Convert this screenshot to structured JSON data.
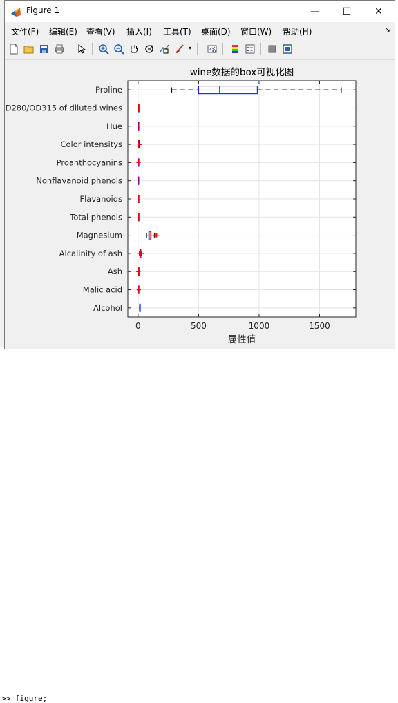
{
  "window": {
    "title": "Figure 1"
  },
  "titlebar_buttons": {
    "minimize": "—",
    "maximize": "☐",
    "close": "✕"
  },
  "menu": [
    {
      "label": "文件(F)"
    },
    {
      "label": "编辑(E)"
    },
    {
      "label": "查看(V)"
    },
    {
      "label": "插入(I)"
    },
    {
      "label": "工具(T)"
    },
    {
      "label": "桌面(D)"
    },
    {
      "label": "窗口(W)"
    },
    {
      "label": "帮助(H)"
    }
  ],
  "toolbar": [
    {
      "icon": "new-figure-icon"
    },
    {
      "icon": "open-file-icon"
    },
    {
      "icon": "save-icon"
    },
    {
      "icon": "print-icon"
    },
    {
      "icon": "edit-plot-arrow-icon"
    },
    {
      "icon": "zoom-in-icon"
    },
    {
      "icon": "zoom-out-icon"
    },
    {
      "icon": "pan-hand-icon"
    },
    {
      "icon": "rotate-3d-icon"
    },
    {
      "icon": "data-cursor-icon"
    },
    {
      "icon": "brush-icon"
    },
    {
      "icon": "link-plot-icon"
    },
    {
      "icon": "colorbar-icon"
    },
    {
      "icon": "legend-icon"
    },
    {
      "icon": "hide-plot-tools-icon"
    },
    {
      "icon": "show-plot-tools-icon"
    }
  ],
  "console": {
    "text": ">> figure;"
  },
  "chart_data": {
    "type": "box",
    "orientation": "horizontal",
    "title": "wine数据的box可视化图",
    "xlabel": "属性值",
    "ylabel": "",
    "xlim": [
      -85,
      1800
    ],
    "xticks": [
      0,
      500,
      1000,
      1500
    ],
    "grid": true,
    "colors": {
      "box": "#0000ff",
      "median": "#ff0000",
      "whisker": "#000000",
      "outlier": "#ff0000"
    },
    "categories": [
      "Proline",
      "OD280/OD315 of diluted wines",
      "Hue",
      "Color intensitys",
      "Proanthocyanins",
      "Nonflavanoid phenols",
      "Flavanoids",
      "Total phenols",
      "Magnesium",
      "Alcalinity of ash",
      "Ash",
      "Malic acid",
      "Alcohol"
    ],
    "boxes": [
      {
        "name": "Proline",
        "min": 278,
        "q1": 500,
        "median": 673,
        "q3": 985,
        "max": 1680,
        "outliers": []
      },
      {
        "name": "OD280/OD315 of diluted wines",
        "min": 1.27,
        "q1": 1.93,
        "median": 2.78,
        "q3": 3.17,
        "max": 4.0,
        "outliers": []
      },
      {
        "name": "Hue",
        "min": 0.48,
        "q1": 0.78,
        "median": 0.965,
        "q3": 1.12,
        "max": 1.71,
        "outliers": []
      },
      {
        "name": "Color intensitys",
        "min": 1.28,
        "q1": 3.22,
        "median": 4.69,
        "q3": 6.2,
        "max": 10.8,
        "outliers": [
          11.75,
          13.0,
          13.0
        ]
      },
      {
        "name": "Proanthocyanins",
        "min": 0.41,
        "q1": 1.25,
        "median": 1.555,
        "q3": 1.95,
        "max": 2.96,
        "outliers": [
          3.28,
          3.58
        ]
      },
      {
        "name": "Nonflavanoid phenols",
        "min": 0.13,
        "q1": 0.27,
        "median": 0.34,
        "q3": 0.44,
        "max": 0.66,
        "outliers": []
      },
      {
        "name": "Flavanoids",
        "min": 0.34,
        "q1": 1.2,
        "median": 2.135,
        "q3": 2.88,
        "max": 5.08,
        "outliers": []
      },
      {
        "name": "Total phenols",
        "min": 0.98,
        "q1": 1.74,
        "median": 2.355,
        "q3": 2.8,
        "max": 3.88,
        "outliers": []
      },
      {
        "name": "Magnesium",
        "min": 70,
        "q1": 88,
        "median": 98,
        "q3": 107,
        "max": 134,
        "outliers": [
          139,
          142,
          151,
          162
        ]
      },
      {
        "name": "Alcalinity of ash",
        "min": 10.6,
        "q1": 17.2,
        "median": 19.5,
        "q3": 21.5,
        "max": 28.5,
        "outliers": [
          10.6,
          30.0
        ]
      },
      {
        "name": "Ash",
        "min": 1.7,
        "q1": 2.21,
        "median": 2.36,
        "q3": 2.56,
        "max": 3.07,
        "outliers": [
          1.36,
          3.22,
          3.23
        ]
      },
      {
        "name": "Malic acid",
        "min": 0.74,
        "q1": 1.6,
        "median": 1.865,
        "q3": 3.08,
        "max": 5.8,
        "outliers": [
          5.19,
          5.65
        ]
      },
      {
        "name": "Alcohol",
        "min": 11.03,
        "q1": 12.36,
        "median": 13.05,
        "q3": 13.68,
        "max": 14.83,
        "outliers": []
      }
    ]
  }
}
